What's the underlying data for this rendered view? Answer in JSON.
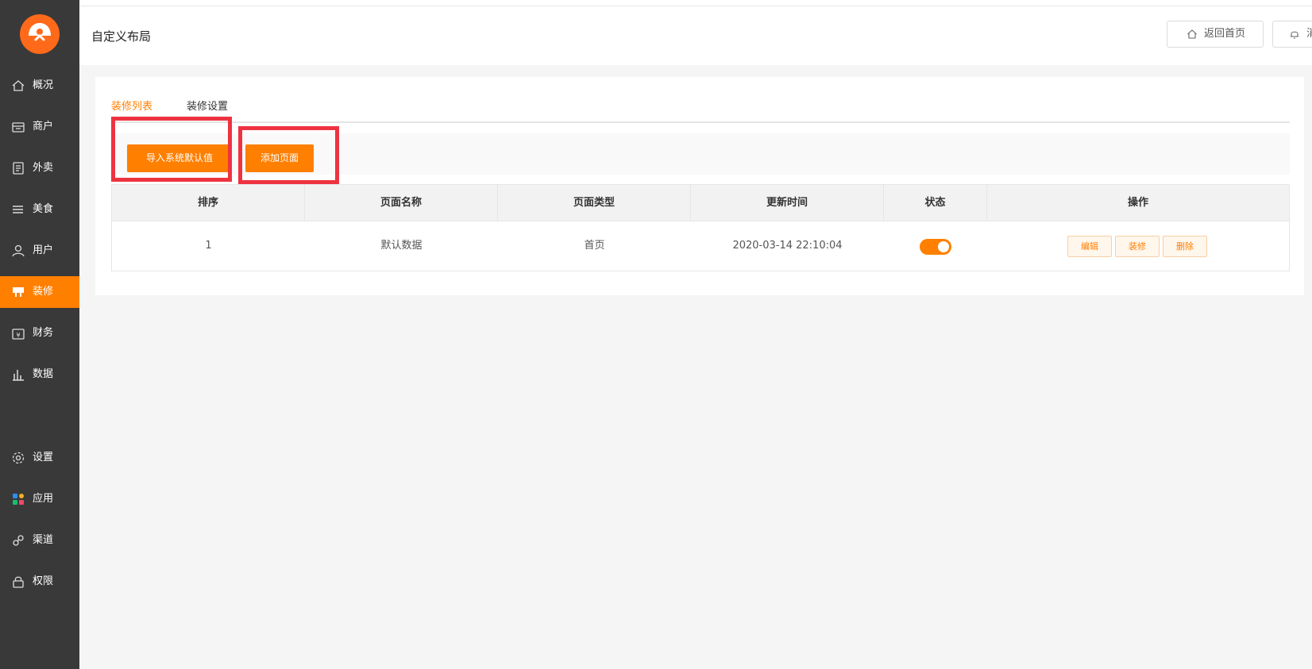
{
  "app": {
    "page_title": "自定义布局",
    "accent_color": "#ff7f00",
    "highlight_color": "#ee3340"
  },
  "sidebar": {
    "items": [
      {
        "label": "概况",
        "icon": "home-icon"
      },
      {
        "label": "商户",
        "icon": "store-icon"
      },
      {
        "label": "外卖",
        "icon": "document-icon"
      },
      {
        "label": "美食",
        "icon": "menu-lines-icon"
      },
      {
        "label": "用户",
        "icon": "user-icon"
      },
      {
        "label": "装修",
        "icon": "brush-icon",
        "active": true
      },
      {
        "label": "财务",
        "icon": "wallet-icon"
      },
      {
        "label": "数据",
        "icon": "bar-chart-icon"
      },
      {
        "label": "设置",
        "icon": "gear-icon"
      },
      {
        "label": "应用",
        "icon": "apps-grid-icon"
      },
      {
        "label": "渠道",
        "icon": "link-icon"
      },
      {
        "label": "权限",
        "icon": "lock-icon"
      }
    ]
  },
  "header": {
    "home_button": "返回首页",
    "notify_button": "消"
  },
  "tabs": [
    {
      "label": "装修列表",
      "active": true
    },
    {
      "label": "装修设置",
      "active": false
    }
  ],
  "toolbar": {
    "import_default": "导入系统默认值",
    "add_page": "添加页面"
  },
  "table": {
    "columns": [
      "排序",
      "页面名称",
      "页面类型",
      "更新时间",
      "状态",
      "操作"
    ],
    "rows": [
      {
        "order": "1",
        "name": "默认数据",
        "type": "首页",
        "updated": "2020-03-14 22:10:04",
        "status_on": true,
        "actions": [
          "编辑",
          "装修",
          "删除"
        ]
      }
    ]
  }
}
